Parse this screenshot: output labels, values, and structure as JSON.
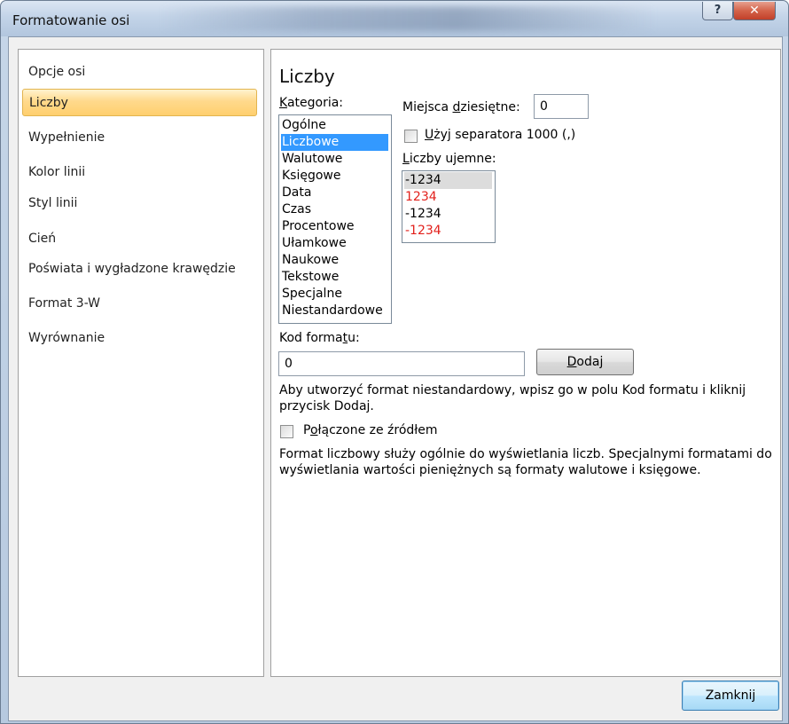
{
  "window": {
    "title": "Formatowanie osi",
    "help_label": "?",
    "close_label": "✕"
  },
  "nav": {
    "items": [
      {
        "label": "Opcje osi"
      },
      {
        "label": "Liczby"
      },
      {
        "label": "Wypełnienie"
      },
      {
        "label": "Kolor linii"
      },
      {
        "label": "Styl linii"
      },
      {
        "label": "Cień"
      },
      {
        "label": "Poświata i wygładzone krawędzie"
      },
      {
        "label": "Format 3-W"
      },
      {
        "label": "Wyrównanie"
      }
    ],
    "selected": "Liczby"
  },
  "panel": {
    "title": "Liczby",
    "category": {
      "label_pre": "",
      "label_u": "K",
      "label_post": "ategoria:",
      "items": [
        "Ogólne",
        "Liczbowe",
        "Walutowe",
        "Księgowe",
        "Data",
        "Czas",
        "Procentowe",
        "Ułamkowe",
        "Naukowe",
        "Tekstowe",
        "Specjalne",
        "Niestandardowe"
      ],
      "selected": "Liczbowe"
    },
    "decimal": {
      "label_pre": "Miejsca ",
      "label_u": "d",
      "label_post": "ziesiętne:",
      "value": "0"
    },
    "separator": {
      "label_pre": "",
      "label_u": "U",
      "label_post": "żyj separatora 1000 (,)",
      "checked": false
    },
    "negative": {
      "label_pre": "",
      "label_u": "L",
      "label_post": "iczby ujemne:",
      "items": [
        {
          "text": "-1234",
          "color": "#000000"
        },
        {
          "text": "1234",
          "color": "#e2211c"
        },
        {
          "text": "-1234",
          "color": "#000000"
        },
        {
          "text": "-1234",
          "color": "#e2211c"
        }
      ],
      "selected_index": 0
    },
    "format_code": {
      "label_pre": "Kod forma",
      "label_u": "t",
      "label_post": "u:",
      "value": "0"
    },
    "add_button": {
      "label_pre": "",
      "label_u": "D",
      "label_post": "odaj"
    },
    "custom_help": "Aby utworzyć format niestandardowy, wpisz go w polu Kod formatu i kliknij przycisk Dodaj.",
    "linked": {
      "label_pre": "P",
      "label_u": "o",
      "label_post": "łączone ze źródłem",
      "checked": false
    },
    "description": "Format liczbowy służy ogólnie do wyświetlania liczb. Specjalnymi formatami do wyświetlania wartości pieniężnych są formaty walutowe i księgowe."
  },
  "footer": {
    "close_label": "Zamknij"
  },
  "colors": {
    "selection_blue": "#3399ff",
    "nav_selected": "#ffd98c",
    "negative_red": "#e2211c"
  }
}
